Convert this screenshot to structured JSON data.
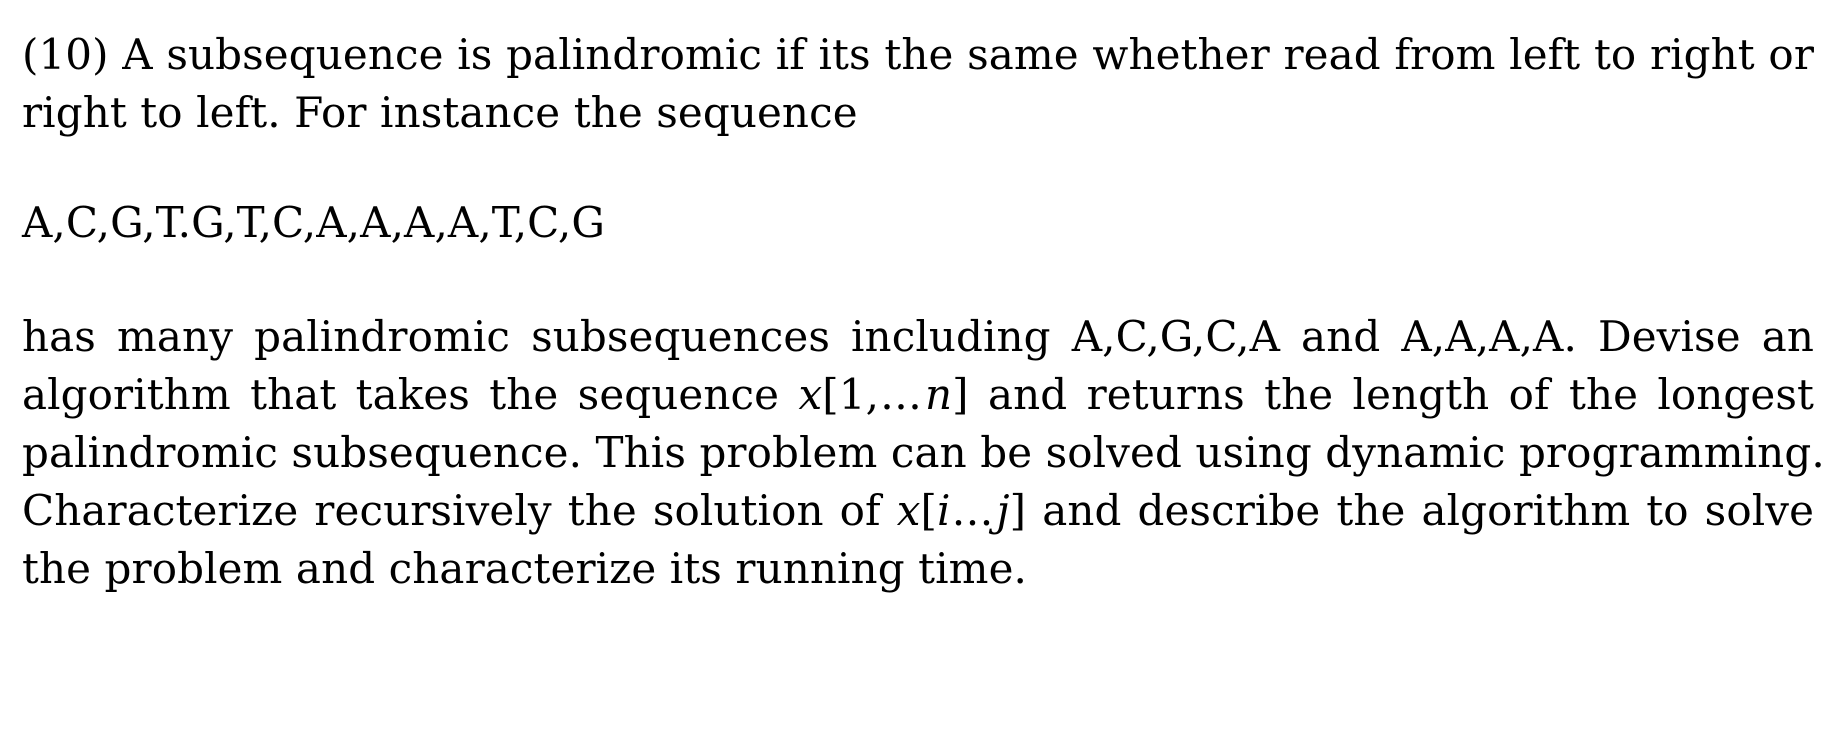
{
  "document": {
    "problem_number": "(10)",
    "paragraph_1": {
      "line_1": "(10) A subsequence is palindromic if its the same whether read from left to right or",
      "line_2": "right to left. For instance the sequence",
      "full_text": "(10) A subsequence is palindromic if its the same whether read from left to right or right to left. For instance the sequence"
    },
    "sequence_block": {
      "text": "A,C,G,T.G,T,C,A,A,A,A,T,C,G",
      "elements": [
        "A",
        "C",
        "G",
        "T",
        "G",
        "T",
        "C",
        "A",
        "A",
        "A",
        "A",
        "T",
        "C",
        "G"
      ]
    },
    "paragraph_2": {
      "line_1": "has many palindromic subsequences including A,C,G,C,A and A,A,A,A. Devise an",
      "line_2_a": "algorithm that takes the sequence",
      "line_2_math": "x[1,…n]",
      "line_2_math_parts": {
        "variable": "x",
        "open_bracket": "[",
        "start": "1",
        "comma": ",",
        "dots": "…",
        "end": "n",
        "close_bracket": "]"
      },
      "line_2_b": "and returns the length of the longest",
      "line_3": "palindromic subsequence. This problem can be solved using dynamic programming.",
      "line_4_a": "Characterize recursively the solution of",
      "line_4_math": "x[i…j]",
      "line_4_math_parts": {
        "variable": "x",
        "open_bracket": "[",
        "start": "i",
        "dots": "…",
        "end": "j",
        "close_bracket": "]"
      },
      "line_4_b": "and describe the algorithm to solve",
      "line_5": "the problem and characterize its running time.",
      "example_palindrome_1": "A,C,G,C,A",
      "example_palindrome_2": "A,A,A,A"
    }
  },
  "theme": {
    "background": "#ffffff",
    "text_color": "#000000"
  }
}
